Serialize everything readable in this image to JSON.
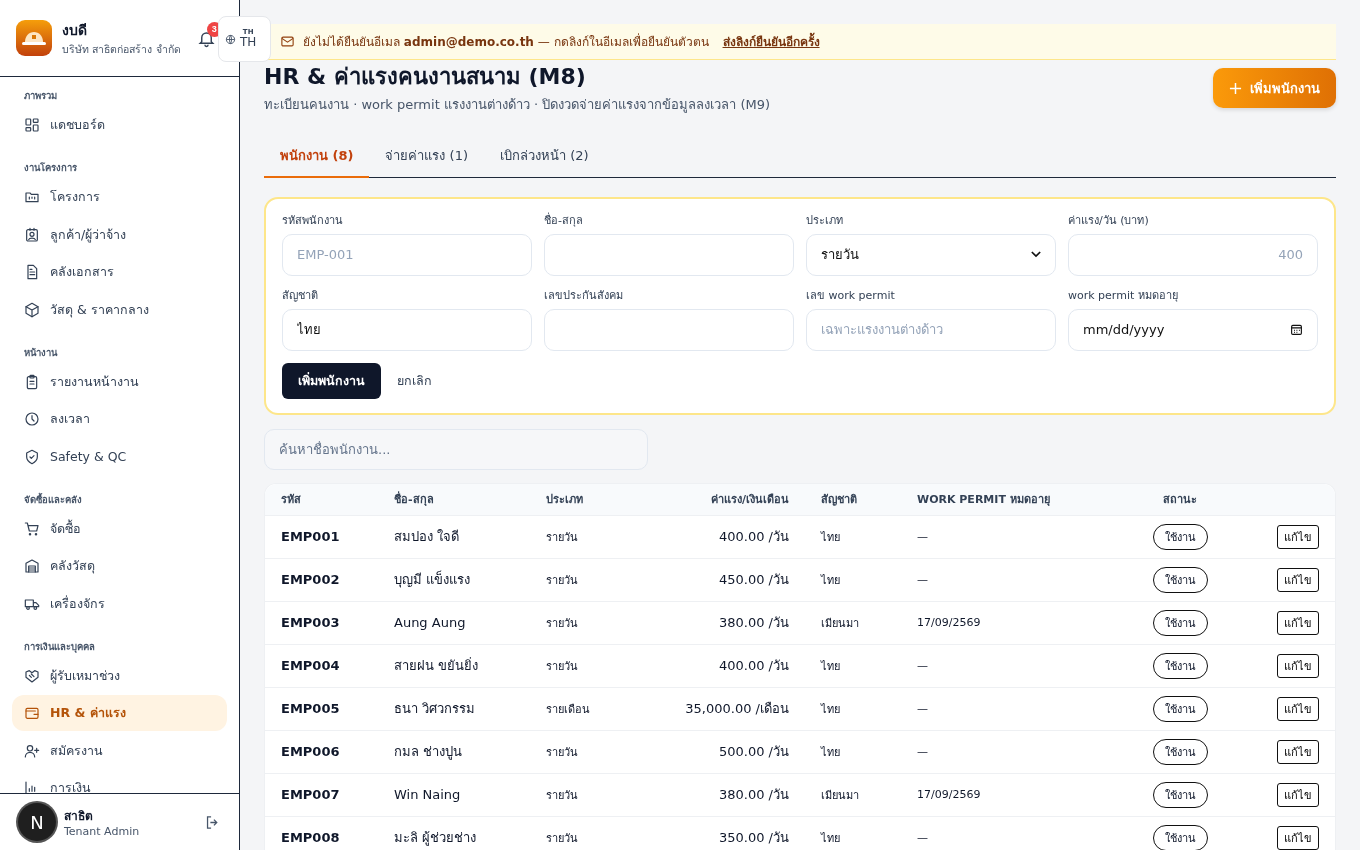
{
  "brand": {
    "name": "งบดี",
    "company": "บริษัท สาธิตก่อสร้าง จำกัด"
  },
  "notifications": {
    "count": "3"
  },
  "language": {
    "code_small": "TH",
    "code": "TH"
  },
  "banner": {
    "text": "ยังไม่ได้ยืนยันอีเมล **admin@demo.co.th** — กดลิงก์ในอีเมลเพื่อยืนยันตัวตน",
    "link": "ส่งลิงก์ยืนยันอีกครั้ง"
  },
  "sidebar": {
    "sections": [
      {
        "title": "ภาพรวม",
        "items": [
          {
            "label": "แดชบอร์ด",
            "selected": false
          }
        ]
      },
      {
        "title": "งานโครงการ",
        "items": [
          {
            "label": "โครงการ",
            "selected": false
          },
          {
            "label": "ลูกค้า/ผู้ว่าจ้าง",
            "selected": false
          },
          {
            "label": "คลังเอกสาร",
            "selected": false
          },
          {
            "label": "วัสดุ & ราคากลาง",
            "selected": false
          }
        ]
      },
      {
        "title": "หน้างาน",
        "items": [
          {
            "label": "รายงานหน้างาน",
            "selected": false
          },
          {
            "label": "ลงเวลา",
            "selected": false
          },
          {
            "label": "Safety & QC",
            "selected": false
          }
        ]
      },
      {
        "title": "จัดซื้อและคลัง",
        "items": [
          {
            "label": "จัดซื้อ",
            "selected": false
          },
          {
            "label": "คลังวัสดุ",
            "selected": false
          },
          {
            "label": "เครื่องจักร",
            "selected": false
          }
        ]
      },
      {
        "title": "การเงินและบุคคล",
        "items": [
          {
            "label": "ผู้รับเหมาช่วง",
            "selected": false
          },
          {
            "label": "HR & ค่าแรง",
            "selected": true
          },
          {
            "label": "สมัครงาน",
            "selected": false
          },
          {
            "label": "การเงิน",
            "selected": false
          }
        ]
      }
    ]
  },
  "user": {
    "avatar_letter": "N",
    "name": "สาธิต",
    "role": "Tenant Admin"
  },
  "page": {
    "title": "HR & ค่าแรงคนงานสนาม (M8)",
    "subtitle": "ทะเบียนคนงาน · work permit แรงงานต่างด้าว · ปิดงวดจ่ายค่าแรงจากข้อมูลลงเวลา (M9)",
    "add_button": "เพิ่มพนักงาน"
  },
  "tabs": [
    {
      "label": "พนักงาน (8)",
      "selected": true
    },
    {
      "label": "จ่ายค่าแรง (1)",
      "selected": false
    },
    {
      "label": "เบิกล่วงหน้า (2)",
      "selected": false
    }
  ],
  "form": {
    "fields": [
      {
        "kind": "text",
        "label": "รหัสพนักงาน",
        "placeholder": "EMP-001"
      },
      {
        "kind": "text",
        "label": "ชื่อ-สกุล"
      },
      {
        "kind": "select",
        "label": "ประเภท",
        "value": "รายวัน"
      },
      {
        "kind": "number",
        "label": "ค่าแรง/วัน (บาท)",
        "placeholder": "400"
      },
      {
        "kind": "text",
        "label": "สัญชาติ",
        "value": "ไทย"
      },
      {
        "kind": "text",
        "label": "เลขประกันสังคม"
      },
      {
        "kind": "text",
        "label": "เลข work permit",
        "placeholder": "เฉพาะแรงงานต่างด้าว"
      },
      {
        "kind": "date",
        "label": "work permit หมดอายุ",
        "value": "mm/dd/yyyy"
      }
    ],
    "submit": "เพิ่มพนักงาน",
    "cancel": "ยกเลิก"
  },
  "search": {
    "placeholder": "ค้นหาชื่อพนักงาน..."
  },
  "table": {
    "columns": [
      "รหัส",
      "ชื่อ-สกุล",
      "ประเภท",
      "ค่าแรง/เงินเดือน",
      "สัญชาติ",
      "WORK PERMIT หมดอายุ",
      "สถานะ"
    ],
    "rows": [
      {
        "code": "EMP001",
        "name": "สมปอง ใจดี",
        "type": "รายวัน",
        "wage": "400.00 /วัน",
        "nationality": "ไทย",
        "permit": "—",
        "status": "ใช้งาน",
        "action": "แก้ไข"
      },
      {
        "code": "EMP002",
        "name": "บุญมี แข็งแรง",
        "type": "รายวัน",
        "wage": "450.00 /วัน",
        "nationality": "ไทย",
        "permit": "—",
        "status": "ใช้งาน",
        "action": "แก้ไข"
      },
      {
        "code": "EMP003",
        "name": "Aung Aung",
        "type": "รายวัน",
        "wage": "380.00 /วัน",
        "nationality": "เมียนมา",
        "permit": "17/09/2569",
        "status": "ใช้งาน",
        "action": "แก้ไข"
      },
      {
        "code": "EMP004",
        "name": "สายฝน ขยันยิ่ง",
        "type": "รายวัน",
        "wage": "400.00 /วัน",
        "nationality": "ไทย",
        "permit": "—",
        "status": "ใช้งาน",
        "action": "แก้ไข"
      },
      {
        "code": "EMP005",
        "name": "ธนา วิศวกรรม",
        "type": "รายเดือน",
        "wage": "35,000.00 /เดือน",
        "nationality": "ไทย",
        "permit": "—",
        "status": "ใช้งาน",
        "action": "แก้ไข"
      },
      {
        "code": "EMP006",
        "name": "กมล ช่างปูน",
        "type": "รายวัน",
        "wage": "500.00 /วัน",
        "nationality": "ไทย",
        "permit": "—",
        "status": "ใช้งาน",
        "action": "แก้ไข"
      },
      {
        "code": "EMP007",
        "name": "Win Naing",
        "type": "รายวัน",
        "wage": "380.00 /วัน",
        "nationality": "เมียนมา",
        "permit": "17/09/2569",
        "status": "ใช้งาน",
        "action": "แก้ไข"
      },
      {
        "code": "EMP008",
        "name": "มะลิ ผู้ช่วยช่าง",
        "type": "รายวัน",
        "wage": "350.00 /วัน",
        "nationality": "ไทย",
        "permit": "—",
        "status": "ใช้งาน",
        "action": "แก้ไข"
      }
    ]
  }
}
